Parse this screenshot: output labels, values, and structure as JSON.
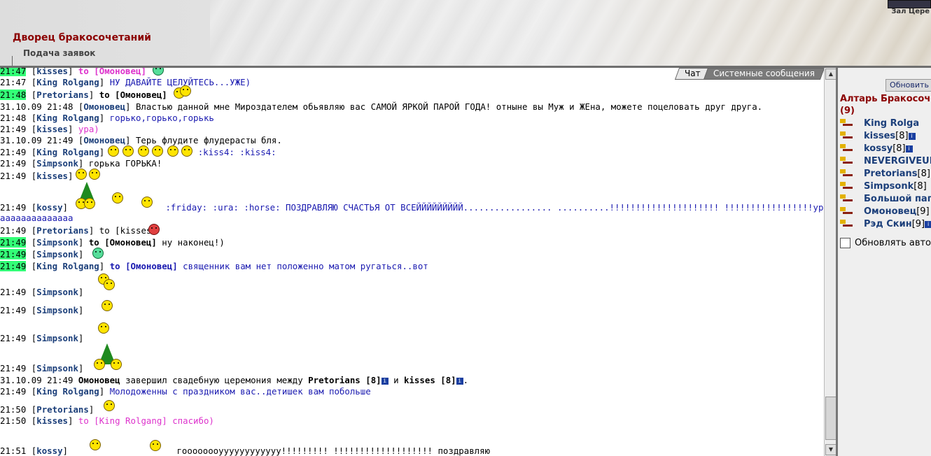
{
  "header": {
    "title": "Дворец бракосочетаний",
    "subtitle": "Подача заявок",
    "hall_link": "Зал Цере"
  },
  "tabs": [
    {
      "label": "Чат"
    },
    {
      "label": "Системные сообщения"
    }
  ],
  "messages": [
    {
      "time": "21:47",
      "nick": "kisses",
      "to": "to [Омоновец]",
      "text": ""
    },
    {
      "time": "21:47",
      "nick": "King Rolgang",
      "text": "НУ ДАВАЙТЕ ЦЕЛУЙТЕСЬ...УЖЕ)"
    },
    {
      "time": "21:48",
      "nick": "Pretorians",
      "to": "to [Омоновец]",
      "text": ""
    },
    {
      "time": "31.10.09 21:48",
      "nick": "Омоновец",
      "text": "Властью данной мне Мироздателем обьявляю вас САМОЙ ЯРКОЙ ПАРОЙ ГОДА! отныне вы Муж и ЖЕна, можете поцеловать друг друга."
    },
    {
      "time": "21:48",
      "nick": "King Rolgang",
      "text": "горько,горько,горькь"
    },
    {
      "time": "21:49",
      "nick": "kisses",
      "text": "ура)"
    },
    {
      "time": "31.10.09 21:49",
      "nick": "Омоновец",
      "text": "Терь флудите флудерасты бля."
    },
    {
      "time": "21:49",
      "nick": "King Rolgang",
      "text": ":kiss4: :kiss4:"
    },
    {
      "time": "21:49",
      "nick": "Simpsonk",
      "text": "горька ГОРЬКА!"
    },
    {
      "time": "21:49",
      "nick": "kisses",
      "text": ""
    },
    {
      "time": "21:49",
      "nick": "kossy",
      "text": ":friday: :ura: :horse: ПОЗДРАВЛЯЮ СЧАСТЬЯ ОТ ВСЕЙЙЙЙЙЙЙЙЙ................. ..........!!!!!!!!!!!!!!!!!!!!! !!!!!!!!!!!!!!!!!урааааааааааа"
    },
    {
      "text": "aaaaaaaaaaaaaa"
    },
    {
      "time": "21:49",
      "nick": "Pretorians",
      "to": "to [kisses]",
      "text": ""
    },
    {
      "time": "21:49",
      "nick": "Simpsonk",
      "to": "to [Омоновец]",
      "text": "ну наконец!)"
    },
    {
      "time": "21:49",
      "nick": "Simpsonk",
      "text": ""
    },
    {
      "time": "21:49",
      "nick": "King Rolgang",
      "to": "to [Омоновец]",
      "text": "священник вам нет положенно матом ругаться..вот"
    },
    {
      "time": "21:49",
      "nick": "Simpsonk",
      "text": ""
    },
    {
      "time": "21:49",
      "nick": "Simpsonk",
      "text": ""
    },
    {
      "time": "21:49",
      "nick": "Simpsonk",
      "text": ""
    },
    {
      "time": "21:49",
      "nick": "Simpsonk",
      "text": ""
    },
    {
      "time": "31.10.09 21:49",
      "nick": "Омоновец",
      "text": "завершил свадебную церемония между",
      "a": "Pretorians [8]",
      "and": "и",
      "b": "kisses [8]",
      "end": "."
    },
    {
      "time": "21:49",
      "nick": "King Rolgang",
      "text": "Молодоженны с праздником вас..детишек вам побольше"
    },
    {
      "time": "21:50",
      "nick": "Pretorians",
      "text": ""
    },
    {
      "time": "21:50",
      "nick": "kisses",
      "to": "to [King Rolgang]",
      "text": "спасибо)"
    },
    {
      "time": "21:51",
      "nick": "kossy",
      "text": "гоооооооуууууууууууу!!!!!!!!! !!!!!!!!!!!!!!!!!!! поздравляю"
    }
  ],
  "sidebar": {
    "refresh": "Обновить",
    "altar": "Алтарь Бракосоче",
    "count": "(9)",
    "users": [
      {
        "name": "King Rolga",
        "level": ""
      },
      {
        "name": "kisses",
        "level": "[8]"
      },
      {
        "name": "kossy",
        "level": "[8]"
      },
      {
        "name": "NEVERGIVEUP",
        "level": ""
      },
      {
        "name": "Pretorians",
        "level": "[8]"
      },
      {
        "name": "Simpsonk",
        "level": "[8]"
      },
      {
        "name": "Большой пап",
        "level": ""
      },
      {
        "name": "Омоновец",
        "level": "[9]"
      },
      {
        "name": "Рэд Скин",
        "level": "[9]"
      }
    ],
    "auto": "Обновлять авто"
  },
  "colors": {
    "accent": "#8b0000",
    "nick": "#1c3f7a",
    "highlight": "#33ff77",
    "private": "#dd33cc"
  }
}
